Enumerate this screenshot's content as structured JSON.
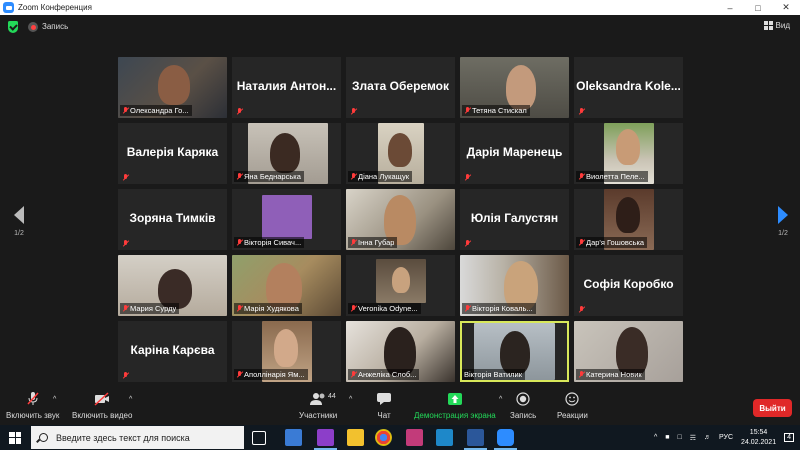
{
  "window": {
    "title": "Zoom Конференция",
    "view_label": "Вид",
    "recording_label": "Запись"
  },
  "gallery": {
    "tiles": [
      {
        "name": "Олександра Го...",
        "video": true
      },
      {
        "name": "Наталия Антон...",
        "video": false
      },
      {
        "name": "Злата Оберемок",
        "video": false
      },
      {
        "name": "Тетяна Стискал",
        "video": true
      },
      {
        "name": "Oleksandra Kole...",
        "video": false
      },
      {
        "name": "Валерія Каряка",
        "video": false
      },
      {
        "name": "Яна Беднарська",
        "video": true
      },
      {
        "name": "Діана Лукащук",
        "video": true
      },
      {
        "name": "Дарія Маренець",
        "video": false
      },
      {
        "name": "Виолетта Пеле...",
        "video": true
      },
      {
        "name": "Зоряна Тимків",
        "video": false
      },
      {
        "name": "Вікторія Сивач...",
        "video": true
      },
      {
        "name": "Інна Губар",
        "video": true
      },
      {
        "name": "Юлія Галустян",
        "video": false
      },
      {
        "name": "Дар'я Гошовська",
        "video": true
      },
      {
        "name": "Мария Сурду",
        "video": true
      },
      {
        "name": "Марія Худякова",
        "video": true
      },
      {
        "name": "Veronika Odyne...",
        "video": true
      },
      {
        "name": "Вікторія Коваль...",
        "video": true
      },
      {
        "name": "Софія Коробко",
        "video": false
      },
      {
        "name": "Каріна Карєва",
        "video": false
      },
      {
        "name": "Аполлінарія Ям...",
        "video": true
      },
      {
        "name": "Анжеліка Слоб...",
        "video": true
      },
      {
        "name": "Вікторія Ватилик",
        "video": true,
        "speaking": true
      },
      {
        "name": "Катерина Новик",
        "video": true
      }
    ],
    "page_left": "1/2",
    "page_right": "1/2"
  },
  "toolbar": {
    "unmute_label": "Включить звук",
    "video_label": "Включить видео",
    "participants_label": "Участники",
    "participants_count": "44",
    "chat_label": "Чат",
    "share_label": "Демонстрация экрана",
    "record_label": "Запись",
    "reactions_label": "Реакции",
    "leave_label": "Выйти"
  },
  "taskbar": {
    "search_placeholder": "Введите здесь текст для поиска",
    "lang": "РУС",
    "time": "15:54",
    "date": "24.02.2021",
    "notifications": "4"
  },
  "colors": {
    "accent": "#2d8cff",
    "share_green": "#23d959",
    "leave_red": "#e02828",
    "speaker_outline": "#d8e85a"
  }
}
